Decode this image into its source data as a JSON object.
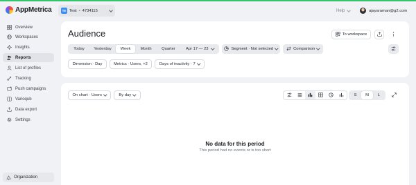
{
  "colors": {
    "accent_stripe": "#35c46b",
    "app_badge": "#3b8ef0",
    "page_bg": "#f1f2f5"
  },
  "app": {
    "name": "AppMetrica"
  },
  "app_selector": {
    "badge": "TE",
    "name": "Test",
    "separator": "•",
    "id": "4734115"
  },
  "header": {
    "help_label": "Help",
    "user_email": "ajayaraman@g2.com"
  },
  "sidebar": {
    "items": [
      {
        "label": "Overview",
        "icon": "grid-icon"
      },
      {
        "label": "Workspaces",
        "icon": "globe-icon"
      },
      {
        "label": "Insights",
        "icon": "sparkle-icon"
      },
      {
        "label": "Reports",
        "icon": "people-icon",
        "active": true
      },
      {
        "label": "List of profiles",
        "icon": "profile-list-icon"
      },
      {
        "label": "Tracking",
        "icon": "tracking-icon"
      },
      {
        "label": "Push campaigns",
        "icon": "push-icon"
      },
      {
        "label": "Varioqub",
        "icon": "varioqub-icon"
      },
      {
        "label": "Data export",
        "icon": "export-icon"
      },
      {
        "label": "Settings",
        "icon": "gear-icon"
      }
    ],
    "organization_label": "Organization"
  },
  "report": {
    "title": "Audience",
    "to_workspace_label": "To workspace",
    "periods": [
      "Today",
      "Yesterday",
      "Week",
      "Month",
      "Quarter"
    ],
    "active_period": "Week",
    "date_range": "Apr 17 — 23",
    "segment_label": "Segment · Not selected",
    "comparison_label": "Comparison",
    "dimension_label": "Dimension · Day",
    "metrics_label": "Metrics · Users, +2",
    "inactivity_label": "Days of inactivity · 7"
  },
  "chart_controls": {
    "on_chart_label": "On chart · Users",
    "by_day_label": "By day",
    "tools": [
      "filters-icon",
      "table-icon",
      "bar-chart-icon",
      "grid-chart-icon",
      "pie-icon",
      "column-chart-icon"
    ],
    "active_tool": "bar-chart-icon",
    "sizes": [
      "S",
      "M",
      "L"
    ],
    "active_size": "M"
  },
  "empty_state": {
    "title": "No data for this period",
    "subtitle": "This period had no events or is too short"
  }
}
